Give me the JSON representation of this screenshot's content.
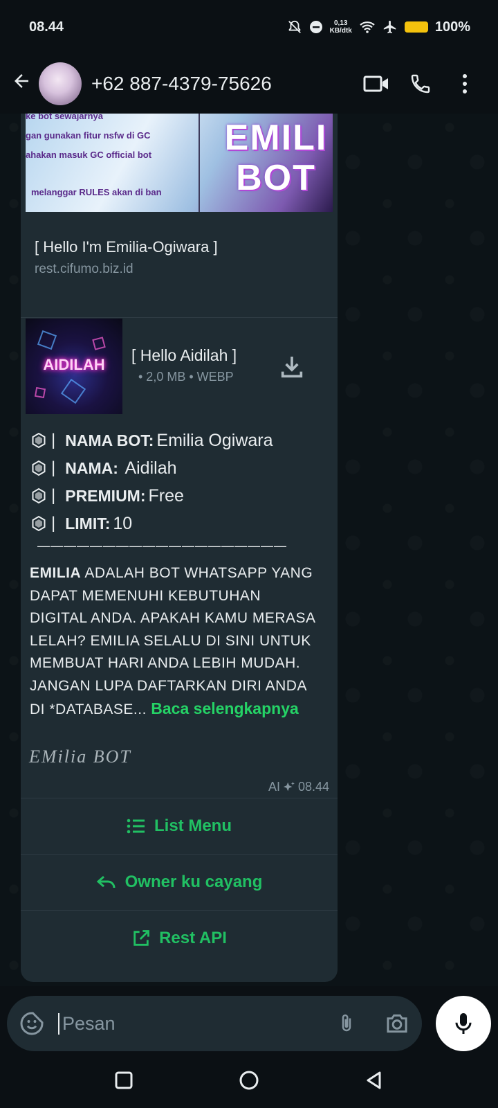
{
  "status_bar": {
    "time": "08.44",
    "net_speed_value": "0,13",
    "net_speed_unit": "KB/dtk",
    "battery": "100%"
  },
  "header": {
    "contact": "+62 887-4379-75626"
  },
  "message": {
    "banner": {
      "lines": [
        "ke bot sewajarnya",
        "gan gunakan fitur nsfw di GC",
        "ahakan masuk GC official bot",
        "melanggar RULES akan di ban"
      ],
      "title": "EMILI BOT"
    },
    "link_preview": {
      "title": "[ Hello I'm Emilia-Ogiwara ]",
      "domain": "rest.cifumo.biz.id"
    },
    "document": {
      "thumb_text": "AIDILAH",
      "name": "[ Hello Aidilah ]",
      "meta": "• 2,0 MB • WEBP"
    },
    "fields": [
      {
        "label": "NAMA BOT:",
        "value": "Emilia Ogiwara"
      },
      {
        "label": "NAMA:",
        "value": " Aidilah"
      },
      {
        "label": "PREMIUM:",
        "value": "Free"
      },
      {
        "label": "LIMIT:",
        "value": "10"
      }
    ],
    "separator": "———————————————————",
    "description_bold": "EMILIA",
    "description": "ADALAH BOT WHATSAPP YANG DAPAT MEMENUHI KEBUTUHAN DIGITAL ANDA. APAKAH KAMU MERASA LELAH? EMILIA SELALU DI SINI UNTUK MEMBUAT HARI ANDA LEBIH MUDAH. JANGAN LUPA DAFTARKAN DIRI ANDA DI *DATABASE...",
    "read_more": "Baca selengkapnya",
    "signature": "EMilia  BOT",
    "ai_label": "AI",
    "time": "08.44",
    "buttons": [
      {
        "label": "List Menu",
        "icon": "list-icon"
      },
      {
        "label": "Owner ku cayang",
        "icon": "reply-icon"
      },
      {
        "label": "Rest API",
        "icon": "external-link-icon"
      }
    ]
  },
  "input": {
    "placeholder": "Pesan"
  },
  "colors": {
    "accent": "#21c063",
    "bubble": "#1f2c33",
    "background": "#0c1317"
  }
}
